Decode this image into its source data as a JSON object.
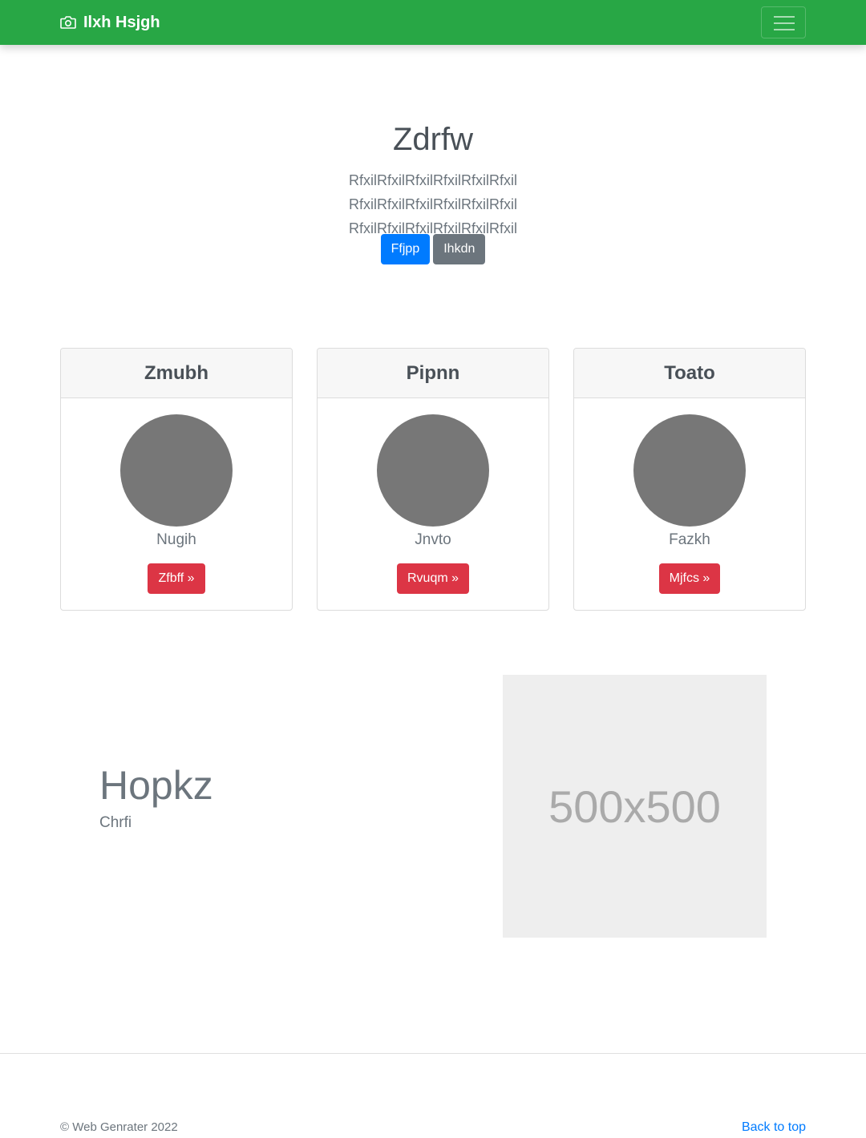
{
  "navbar": {
    "brand_icon": "camera-icon",
    "brand": "Ilxh Hsjgh",
    "toggler_icon": "hamburger-menu-icon",
    "background": "#28a745"
  },
  "hero": {
    "title": "Zdrfw",
    "lead": "RfxilRfxilRfxilRfxilRfxilRfxil RfxilRfxilRfxilRfxilRfxilRfxil RfxilRfxilRfxilRfxilRfxilRfxil",
    "primary_button": "Ffjpp",
    "secondary_button": "Ihkdn"
  },
  "cards": [
    {
      "title": "Zmubh",
      "name": "Nugih",
      "button": "Zfbff »"
    },
    {
      "title": "Pipnn",
      "name": "Jnvto",
      "button": "Rvuqm »"
    },
    {
      "title": "Toato",
      "name": "Fazkh",
      "button": "Mjfcs »"
    }
  ],
  "feature": {
    "heading": "Hopkz",
    "subheading": "Chrfi",
    "image_label": "500x500"
  },
  "footer": {
    "copyright": "© Web Genrater 2022",
    "back_to_top": "Back to top"
  },
  "colors": {
    "primary": "#007bff",
    "secondary": "#6c757d",
    "danger": "#dc3545",
    "avatar": "#777777",
    "placeholder": "#eeeeee"
  }
}
